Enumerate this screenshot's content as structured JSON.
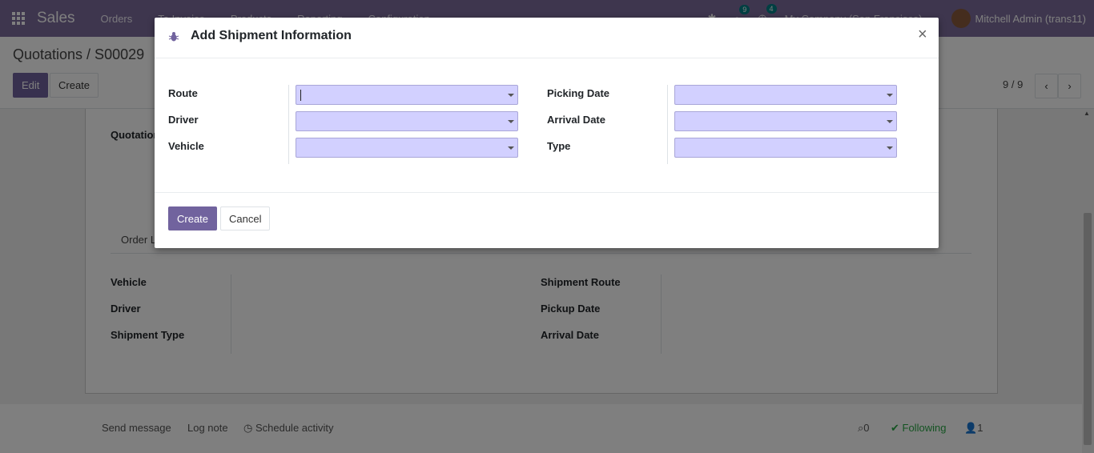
{
  "navbar": {
    "app_name": "Sales",
    "menu": [
      "Orders",
      "To Invoice",
      "Products",
      "Reporting",
      "Configuration"
    ],
    "messages_count": "9",
    "activities_count": "4",
    "company": "My Company (San Francisco)",
    "user": "Mitchell Admin (trans11)"
  },
  "control_panel": {
    "breadcrumb": "Quotations / S00029",
    "edit_label": "Edit",
    "create_label": "Create",
    "pager": "9 / 9"
  },
  "sheet": {
    "title_partial": "Quotation",
    "tab_partial": "Order L",
    "left_fields": [
      "Vehicle",
      "Driver",
      "Shipment Type"
    ],
    "right_fields": [
      "Shipment Route",
      "Pickup Date",
      "Arrival Date"
    ]
  },
  "chatter": {
    "send_message": "Send message",
    "log_note": "Log note",
    "schedule_activity": "Schedule activity",
    "attachments": "0",
    "following": "Following",
    "followers": "1"
  },
  "modal": {
    "title": "Add Shipment Information",
    "close_glyph": "×",
    "left_fields": [
      {
        "label": "Route",
        "value": ""
      },
      {
        "label": "Driver",
        "value": ""
      },
      {
        "label": "Vehicle",
        "value": ""
      }
    ],
    "right_fields": [
      {
        "label": "Picking Date",
        "value": ""
      },
      {
        "label": "Arrival Date",
        "value": ""
      },
      {
        "label": "Type",
        "value": ""
      }
    ],
    "create_label": "Create",
    "cancel_label": "Cancel"
  },
  "colors": {
    "navbar": "#7c6d9c",
    "primary": "#71639e",
    "required_field": "#d2d0ff",
    "following": "#28a745"
  }
}
